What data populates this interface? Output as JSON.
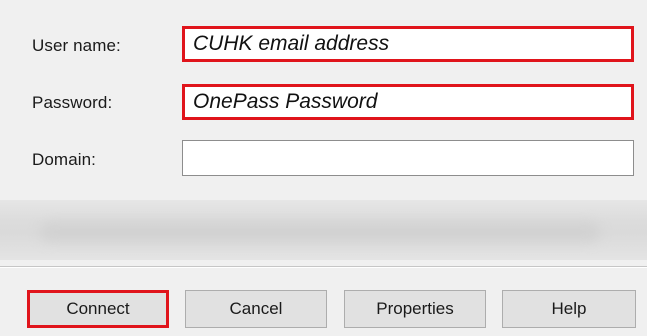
{
  "form": {
    "username": {
      "label": "User name:",
      "value": "CUHK email address"
    },
    "password": {
      "label": "Password:",
      "value": "OnePass Password"
    },
    "domain": {
      "label": "Domain:",
      "value": ""
    }
  },
  "buttons": {
    "connect": "Connect",
    "cancel": "Cancel",
    "properties": "Properties",
    "help": "Help"
  },
  "colors": {
    "highlight": "#e0141b",
    "dialog_bg": "#f0f0f0",
    "button_bg": "#e1e1e1"
  }
}
